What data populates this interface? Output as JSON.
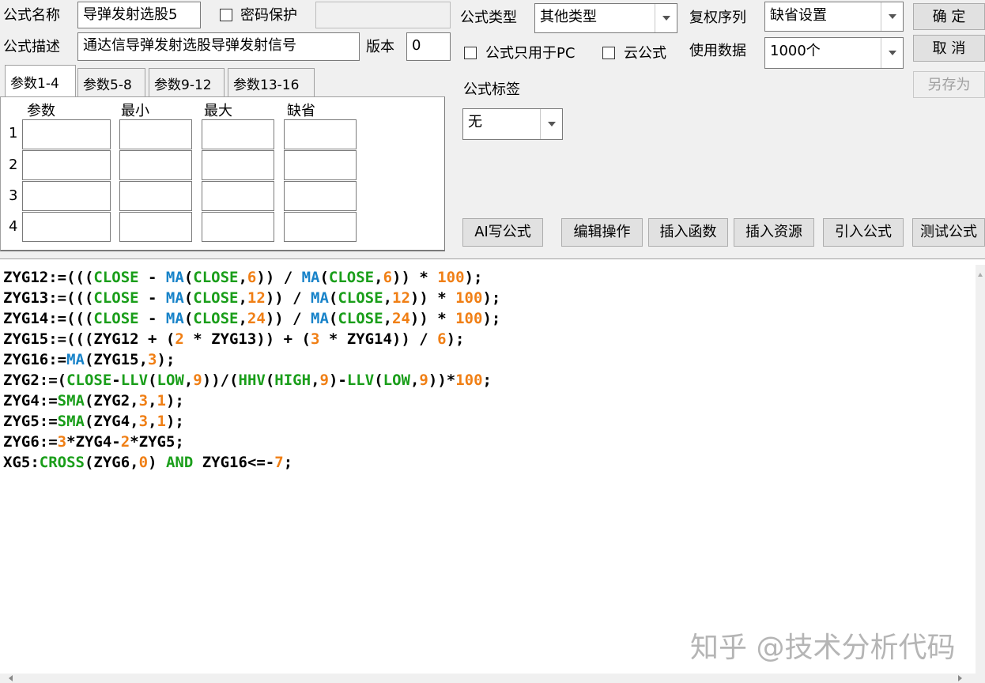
{
  "header": {
    "name_label": "公式名称",
    "name_value": "导弹发射选股5",
    "password_label": "密码保护",
    "password_value": "",
    "desc_label": "公式描述",
    "desc_value": "通达信导弹发射选股导弹发射信号",
    "version_label": "版本",
    "version_value": "0",
    "type_label": "公式类型",
    "type_value": "其他类型",
    "adjust_label": "复权序列",
    "adjust_value": "缺省设置",
    "pc_only_label": "公式只用于PC",
    "cloud_label": "云公式",
    "data_label": "使用数据",
    "data_value": "1000个",
    "tag_label": "公式标签",
    "tag_value": "无"
  },
  "buttons": {
    "ok": "确 定",
    "cancel": "取 消",
    "save_as": "另存为",
    "ai_write": "AI写公式",
    "edit_ops": "编辑操作",
    "insert_func": "插入函数",
    "insert_res": "插入资源",
    "import_formula": "引入公式",
    "test_formula": "测试公式"
  },
  "params": {
    "tabs": [
      "参数1-4",
      "参数5-8",
      "参数9-12",
      "参数13-16"
    ],
    "columns": [
      "参数",
      "最小",
      "最大",
      "缺省"
    ],
    "rows": [
      "1",
      "2",
      "3",
      "4"
    ]
  },
  "code_lines": [
    [
      [
        "ZYG12:=(((",
        ""
      ],
      [
        "CLOSE",
        "g"
      ],
      [
        " - ",
        ""
      ],
      [
        "MA",
        "b"
      ],
      [
        "(",
        ""
      ],
      [
        "CLOSE",
        "g"
      ],
      [
        ",",
        ""
      ],
      [
        "6",
        "o"
      ],
      [
        ")) / ",
        ""
      ],
      [
        "MA",
        "b"
      ],
      [
        "(",
        ""
      ],
      [
        "CLOSE",
        "g"
      ],
      [
        ",",
        ""
      ],
      [
        "6",
        "o"
      ],
      [
        ")) * ",
        ""
      ],
      [
        "100",
        "o"
      ],
      [
        ");",
        ""
      ]
    ],
    [
      [
        "ZYG13:=(((",
        ""
      ],
      [
        "CLOSE",
        "g"
      ],
      [
        " - ",
        ""
      ],
      [
        "MA",
        "b"
      ],
      [
        "(",
        ""
      ],
      [
        "CLOSE",
        "g"
      ],
      [
        ",",
        ""
      ],
      [
        "12",
        "o"
      ],
      [
        ")) / ",
        ""
      ],
      [
        "MA",
        "b"
      ],
      [
        "(",
        ""
      ],
      [
        "CLOSE",
        "g"
      ],
      [
        ",",
        ""
      ],
      [
        "12",
        "o"
      ],
      [
        ")) * ",
        ""
      ],
      [
        "100",
        "o"
      ],
      [
        ");",
        ""
      ]
    ],
    [
      [
        "ZYG14:=(((",
        ""
      ],
      [
        "CLOSE",
        "g"
      ],
      [
        " - ",
        ""
      ],
      [
        "MA",
        "b"
      ],
      [
        "(",
        ""
      ],
      [
        "CLOSE",
        "g"
      ],
      [
        ",",
        ""
      ],
      [
        "24",
        "o"
      ],
      [
        ")) / ",
        ""
      ],
      [
        "MA",
        "b"
      ],
      [
        "(",
        ""
      ],
      [
        "CLOSE",
        "g"
      ],
      [
        ",",
        ""
      ],
      [
        "24",
        "o"
      ],
      [
        ")) * ",
        ""
      ],
      [
        "100",
        "o"
      ],
      [
        ");",
        ""
      ]
    ],
    [
      [
        "ZYG15:=(((ZYG12 + (",
        ""
      ],
      [
        "2",
        "o"
      ],
      [
        " * ZYG13)) + (",
        ""
      ],
      [
        "3",
        "o"
      ],
      [
        " * ZYG14)) / ",
        ""
      ],
      [
        "6",
        "o"
      ],
      [
        ");",
        ""
      ]
    ],
    [
      [
        "ZYG16:=",
        ""
      ],
      [
        "MA",
        "b"
      ],
      [
        "(ZYG15,",
        ""
      ],
      [
        "3",
        "o"
      ],
      [
        ");",
        ""
      ]
    ],
    [
      [
        "ZYG2:=(",
        ""
      ],
      [
        "CLOSE",
        "g"
      ],
      [
        "-",
        ""
      ],
      [
        "LLV",
        "g"
      ],
      [
        "(",
        ""
      ],
      [
        "LOW",
        "g"
      ],
      [
        ",",
        ""
      ],
      [
        "9",
        "o"
      ],
      [
        "))/(",
        ""
      ],
      [
        "HHV",
        "g"
      ],
      [
        "(",
        ""
      ],
      [
        "HIGH",
        "g"
      ],
      [
        ",",
        ""
      ],
      [
        "9",
        "o"
      ],
      [
        ")-",
        ""
      ],
      [
        "LLV",
        "g"
      ],
      [
        "(",
        ""
      ],
      [
        "LOW",
        "g"
      ],
      [
        ",",
        ""
      ],
      [
        "9",
        "o"
      ],
      [
        "))*",
        ""
      ],
      [
        "100",
        "o"
      ],
      [
        ";",
        ""
      ]
    ],
    [
      [
        "ZYG4:=",
        ""
      ],
      [
        "SMA",
        "g"
      ],
      [
        "(ZYG2,",
        ""
      ],
      [
        "3",
        "o"
      ],
      [
        ",",
        ""
      ],
      [
        "1",
        "o"
      ],
      [
        ");",
        ""
      ]
    ],
    [
      [
        "ZYG5:=",
        ""
      ],
      [
        "SMA",
        "g"
      ],
      [
        "(ZYG4,",
        ""
      ],
      [
        "3",
        "o"
      ],
      [
        ",",
        ""
      ],
      [
        "1",
        "o"
      ],
      [
        ");",
        ""
      ]
    ],
    [
      [
        "ZYG6:=",
        ""
      ],
      [
        "3",
        "o"
      ],
      [
        "*ZYG4-",
        ""
      ],
      [
        "2",
        "o"
      ],
      [
        "*ZYG5;",
        ""
      ]
    ],
    [
      [
        "XG5:",
        ""
      ],
      [
        "CROSS",
        "g"
      ],
      [
        "(ZYG6,",
        ""
      ],
      [
        "0",
        "o"
      ],
      [
        ") ",
        ""
      ],
      [
        "AND",
        "g"
      ],
      [
        " ZYG16<=-",
        ""
      ],
      [
        "7",
        "o"
      ],
      [
        ";",
        ""
      ]
    ]
  ],
  "watermark": "知乎 @技术分析代码"
}
